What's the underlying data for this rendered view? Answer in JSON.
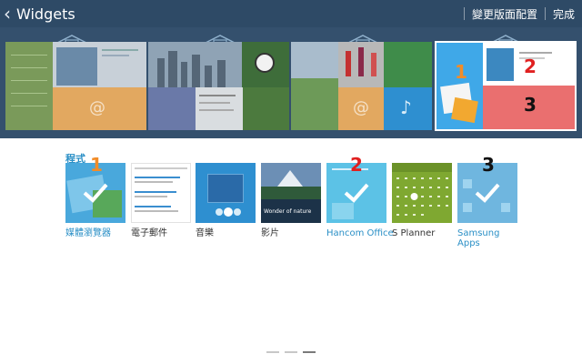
{
  "header": {
    "title": "Widgets",
    "action_change_layout": "變更版面配置",
    "action_done": "完成"
  },
  "preview": {
    "badge_1": "1",
    "badge_2": "2",
    "badge_3": "3"
  },
  "apps_section": {
    "label": "程式",
    "apps": [
      {
        "label": "媒體瀏覽器",
        "badge": "1"
      },
      {
        "label": "電子郵件"
      },
      {
        "label": "音樂"
      },
      {
        "label": "影片",
        "caption": "Wonder of nature"
      },
      {
        "label": "Hancom Office",
        "badge": "2"
      },
      {
        "label": "S Planner"
      },
      {
        "label": "Samsung Apps",
        "badge": "3"
      }
    ]
  },
  "colors": {
    "header_bg": "#2e4a66",
    "selected_text": "#2a8fc6",
    "badge_orange": "#f28c28",
    "badge_red": "#e02020",
    "badge_black": "#111111"
  },
  "icons": [
    "chevron-left-icon",
    "home-outline-icon",
    "checkmark-icon",
    "at-sign-icon"
  ]
}
